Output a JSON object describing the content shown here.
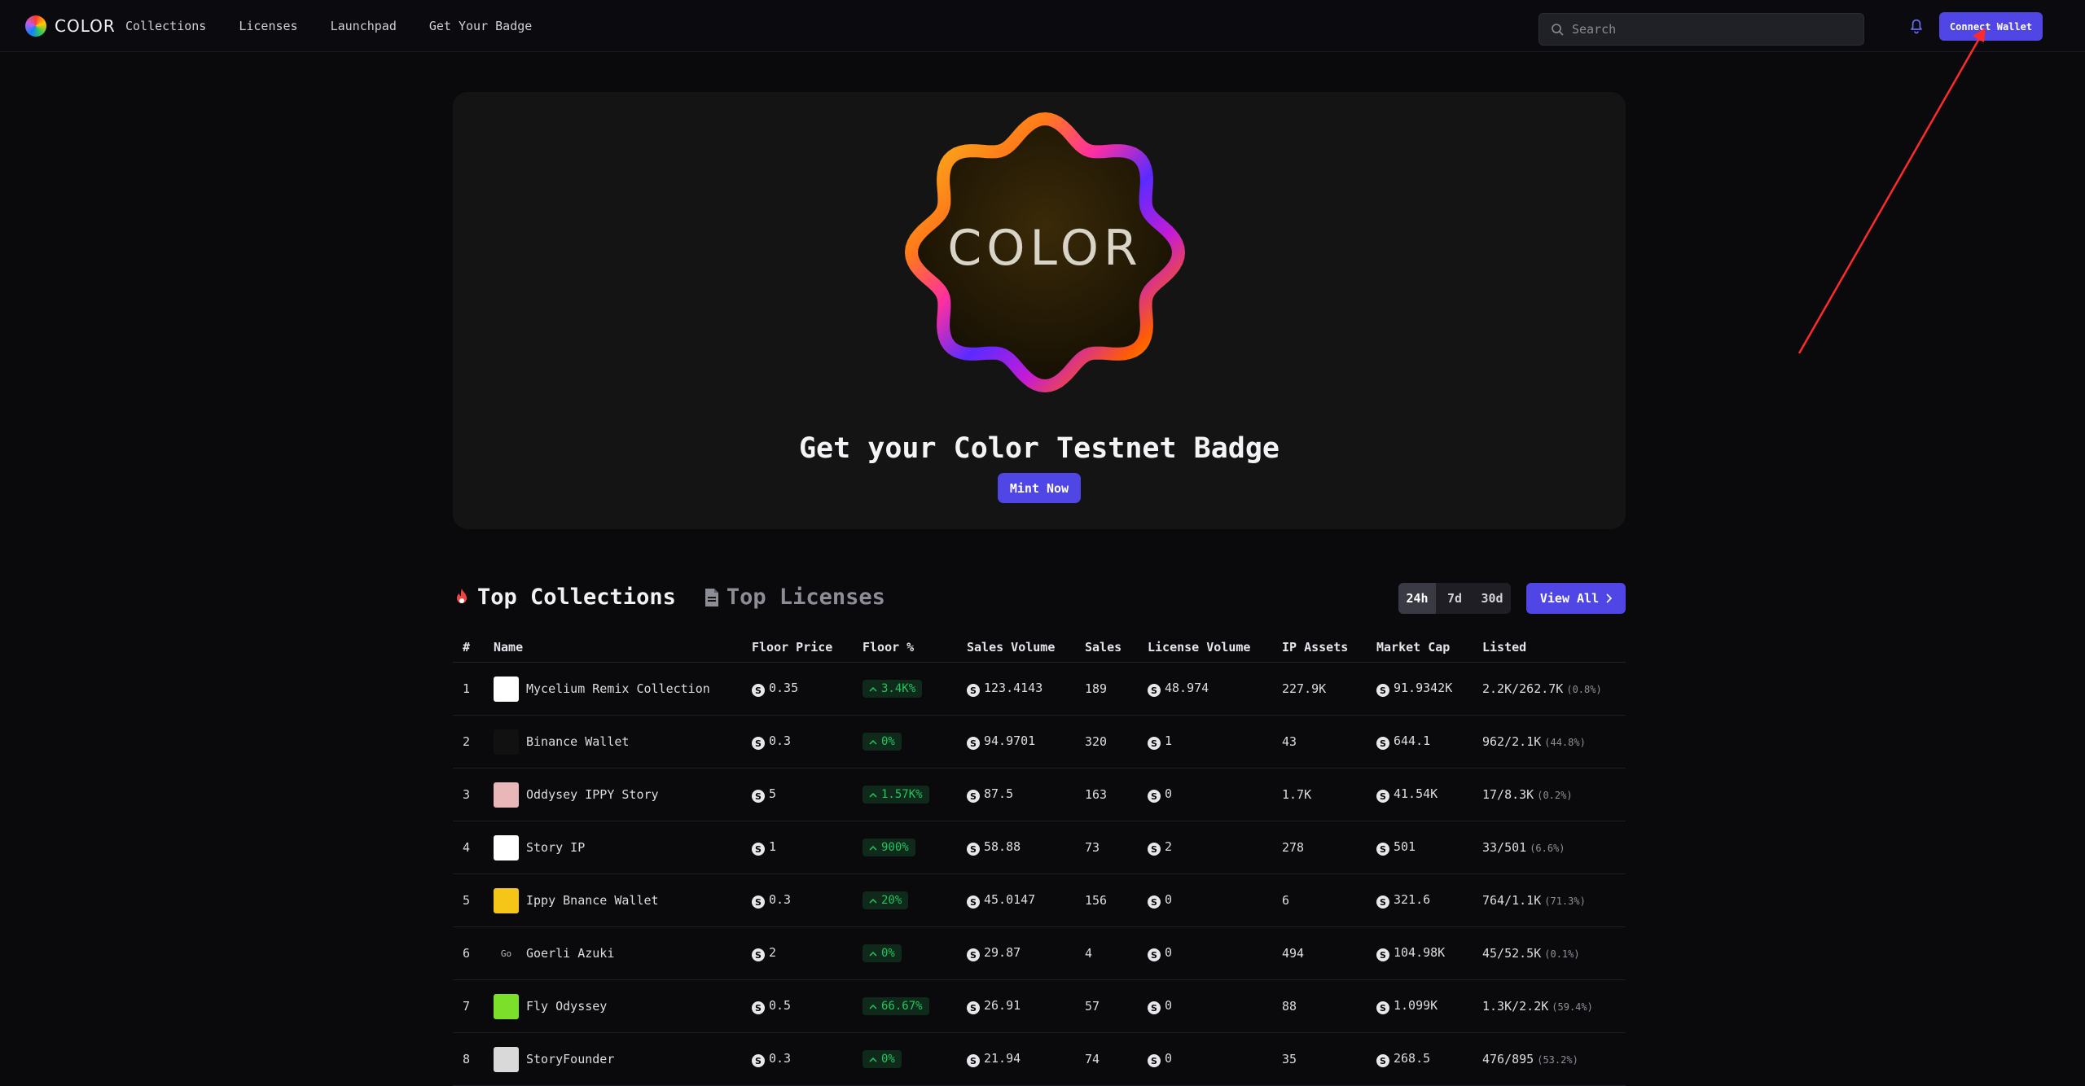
{
  "nav": {
    "brand": "COLOR",
    "links": [
      "Collections",
      "Licenses",
      "Launchpad",
      "Get Your Badge"
    ],
    "search_placeholder": "Search",
    "connect_label": "Connect Wallet"
  },
  "hero": {
    "badge_text": "COLOR",
    "title": "Get your Color Testnet Badge",
    "mint_label": "Mint Now"
  },
  "tabs": {
    "collections": "Top Collections",
    "licenses": "Top Licenses",
    "periods": [
      "24h",
      "7d",
      "30d"
    ],
    "active_period": "24h",
    "view_all": "View All"
  },
  "table": {
    "headers": [
      "#",
      "Name",
      "Floor Price",
      "Floor %",
      "Sales Volume",
      "Sales",
      "License Volume",
      "IP Assets",
      "Market Cap",
      "Listed"
    ],
    "rows": [
      {
        "rank": "1",
        "name": "Mycelium Remix Collection",
        "floor": "0.35",
        "pct": "3.4K%",
        "volume": "123.4143",
        "sales": "189",
        "license": "48.974",
        "ip": "227.9K",
        "cap": "91.9342K",
        "listed": "2.2K/262.7K",
        "listed_pct": "(0.8%)",
        "thumb_color": "#ffffff"
      },
      {
        "rank": "2",
        "name": "Binance Wallet",
        "floor": "0.3",
        "pct": "0%",
        "volume": "94.9701",
        "sales": "320",
        "license": "1",
        "ip": "43",
        "cap": "644.1",
        "listed": "962/2.1K",
        "listed_pct": "(44.8%)",
        "thumb_color": "#111111"
      },
      {
        "rank": "3",
        "name": "Oddysey IPPY Story",
        "floor": "5",
        "pct": "1.57K%",
        "volume": "87.5",
        "sales": "163",
        "license": "0",
        "ip": "1.7K",
        "cap": "41.54K",
        "listed": "17/8.3K",
        "listed_pct": "(0.2%)",
        "thumb_color": "#e9b7b7"
      },
      {
        "rank": "4",
        "name": "Story IP",
        "floor": "1",
        "pct": "900%",
        "volume": "58.88",
        "sales": "73",
        "license": "2",
        "ip": "278",
        "cap": "501",
        "listed": "33/501",
        "listed_pct": "(6.6%)",
        "thumb_color": "#ffffff"
      },
      {
        "rank": "5",
        "name": "Ippy Bnance Wallet",
        "floor": "0.3",
        "pct": "20%",
        "volume": "45.0147",
        "sales": "156",
        "license": "0",
        "ip": "6",
        "cap": "321.6",
        "listed": "764/1.1K",
        "listed_pct": "(71.3%)",
        "thumb_color": "#f5c518"
      },
      {
        "rank": "6",
        "name": "Goerli Azuki",
        "floor": "2",
        "pct": "0%",
        "volume": "29.87",
        "sales": "4",
        "license": "0",
        "ip": "494",
        "cap": "104.98K",
        "listed": "45/52.5K",
        "listed_pct": "(0.1%)",
        "thumb_color": "#0a0a0d",
        "thumb_alt": "Go"
      },
      {
        "rank": "7",
        "name": "Fly Odyssey",
        "floor": "0.5",
        "pct": "66.67%",
        "volume": "26.91",
        "sales": "57",
        "license": "0",
        "ip": "88",
        "cap": "1.099K",
        "listed": "1.3K/2.2K",
        "listed_pct": "(59.4%)",
        "thumb_color": "#7cdf2a"
      },
      {
        "rank": "8",
        "name": "StoryFounder",
        "floor": "0.3",
        "pct": "0%",
        "volume": "21.94",
        "sales": "74",
        "license": "0",
        "ip": "35",
        "cap": "268.5",
        "listed": "476/895",
        "listed_pct": "(53.2%)",
        "thumb_color": "#d9d9d9"
      }
    ]
  },
  "colors": {
    "accent": "#4f46e5",
    "positive": "#22c55e",
    "annotation": "#ff2a2a"
  }
}
